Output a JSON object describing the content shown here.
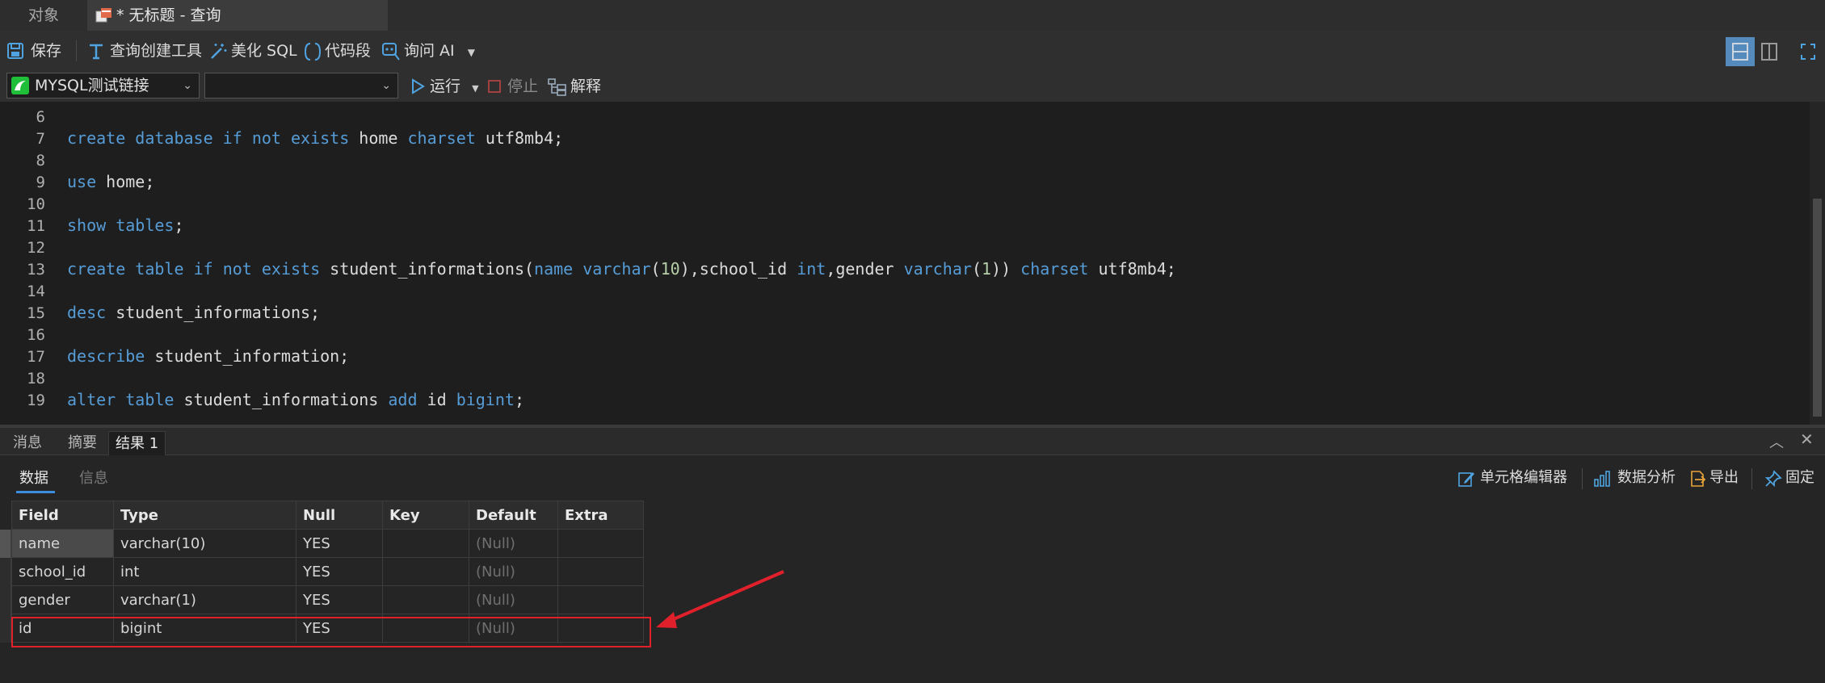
{
  "tabs": {
    "objects": "对象",
    "query": "* 无标题 - 查询"
  },
  "toolbar": {
    "save": "保存",
    "query_builder": "查询创建工具",
    "beautify_sql": "美化 SQL",
    "code_snippet": "代码段",
    "ask_ai": "询问 AI"
  },
  "toolbar2": {
    "connection": "MYSQL测试链接",
    "database": "",
    "run": "运行",
    "stop": "停止",
    "explain": "解释"
  },
  "editor": {
    "line_numbers": [
      "6",
      "7",
      "8",
      "9",
      "10",
      "11",
      "12",
      "13",
      "14",
      "15",
      "16",
      "17",
      "18",
      "19"
    ],
    "lines": [
      "",
      "create database if not exists home charset utf8mb4;",
      "",
      "use home;",
      "",
      "show tables;",
      "",
      "create table if not exists student_informations(name varchar(10),school_id int,gender varchar(1)) charset utf8mb4;",
      "",
      "desc student_informations;",
      "",
      "describe student_information;",
      "",
      "alter table student_informations add id bigint;"
    ]
  },
  "result_tabs": {
    "messages": "消息",
    "summary": "摘要",
    "result1": "结果 1"
  },
  "result_subtabs": {
    "data": "数据",
    "info": "信息"
  },
  "result_tools": {
    "cell_editor": "单元格编辑器",
    "data_analysis": "数据分析",
    "export": "导出",
    "pin": "固定"
  },
  "grid": {
    "columns": [
      "Field",
      "Type",
      "Null",
      "Key",
      "Default",
      "Extra"
    ],
    "rows": [
      [
        "name",
        "varchar(10)",
        "YES",
        "",
        "(Null)",
        ""
      ],
      [
        "school_id",
        "int",
        "YES",
        "",
        "(Null)",
        ""
      ],
      [
        "gender",
        "varchar(1)",
        "YES",
        "",
        "(Null)",
        ""
      ],
      [
        "id",
        "bigint",
        "YES",
        "",
        "(Null)",
        ""
      ]
    ]
  },
  "annotation": {
    "highlight_color": "#e0202a",
    "highlighted_row": "id"
  }
}
